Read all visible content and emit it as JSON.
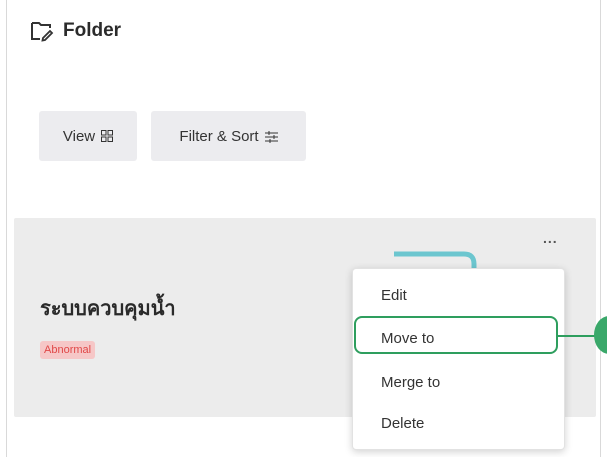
{
  "header": {
    "icon": "folder-edit-icon",
    "title": "Folder"
  },
  "toolbar": {
    "view_label": "View",
    "view_icon": "grid-icon",
    "filter_label": "Filter & Sort",
    "filter_icon": "sliders-icon"
  },
  "card": {
    "title": "ระบบควบคุมน้ำ",
    "status": "Abnormal",
    "more_label": "..."
  },
  "menu": {
    "items": [
      {
        "label": "Edit"
      },
      {
        "label": "Move to"
      },
      {
        "label": "Merge to"
      },
      {
        "label": "Delete"
      }
    ],
    "highlighted_item": "Move to"
  },
  "colors": {
    "accent": "#2e9e5e",
    "badge_bg": "#f6c7c7",
    "badge_text": "#e04848",
    "card_bg": "#ececec"
  }
}
